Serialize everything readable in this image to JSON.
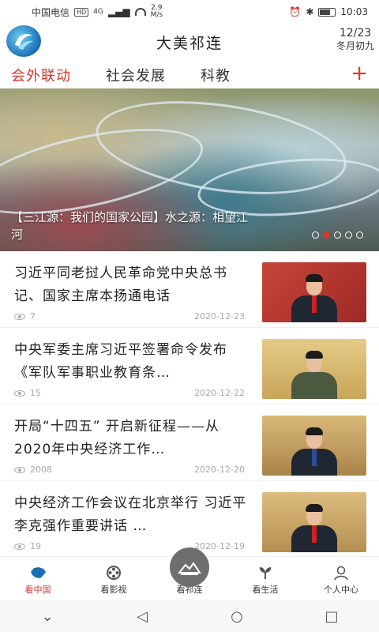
{
  "status_bar": {
    "carrier": "中国电信",
    "hd": "HD",
    "signal": "4G",
    "speed_value": "2.9",
    "speed_unit": "M/s",
    "time": "10:03"
  },
  "header": {
    "title": "大美祁连",
    "date": "12/23",
    "lunar_date": "冬月初九"
  },
  "tabs": [
    {
      "label": "会外联动",
      "active": true
    },
    {
      "label": "社会发展",
      "active": false
    },
    {
      "label": "科教",
      "active": false
    }
  ],
  "tab_add": "+",
  "banner": {
    "caption": "【三江源：我们的国家公园】水之源：相望江河",
    "page_count": 5,
    "active_index": 1
  },
  "news": [
    {
      "title": "习近平同老挝人民革命党中央总书记、国家主席本扬通电话",
      "views": "7",
      "date": "2020-12-23",
      "thumb_bg": "#b8372d"
    },
    {
      "title": "中央军委主席习近平签署命令发布《军队军事职业教育条…",
      "views": "15",
      "date": "2020-12-22",
      "thumb_bg": "#d8b96a"
    },
    {
      "title": "开局“十四五” 开启新征程——从2020年中央经济工作…",
      "views": "2008",
      "date": "2020-12-20",
      "thumb_bg": "#c9a55b"
    },
    {
      "title": "中央经济工作会议在北京举行 习近平李克强作重要讲话 …",
      "views": "19",
      "date": "2020-12-19",
      "thumb_bg": "#caa867"
    }
  ],
  "bottom_nav": [
    {
      "label": "看中国",
      "icon": "china-map-icon",
      "active": true
    },
    {
      "label": "看影视",
      "icon": "film-reel-icon",
      "active": false
    },
    {
      "label": "看祁连",
      "icon": "mountain-icon",
      "active": false
    },
    {
      "label": "看生活",
      "icon": "sprout-icon",
      "active": false
    },
    {
      "label": "个人中心",
      "icon": "user-icon",
      "active": false
    }
  ],
  "colors": {
    "accent": "#d9362b",
    "brand_blue": "#1a6fb8"
  }
}
